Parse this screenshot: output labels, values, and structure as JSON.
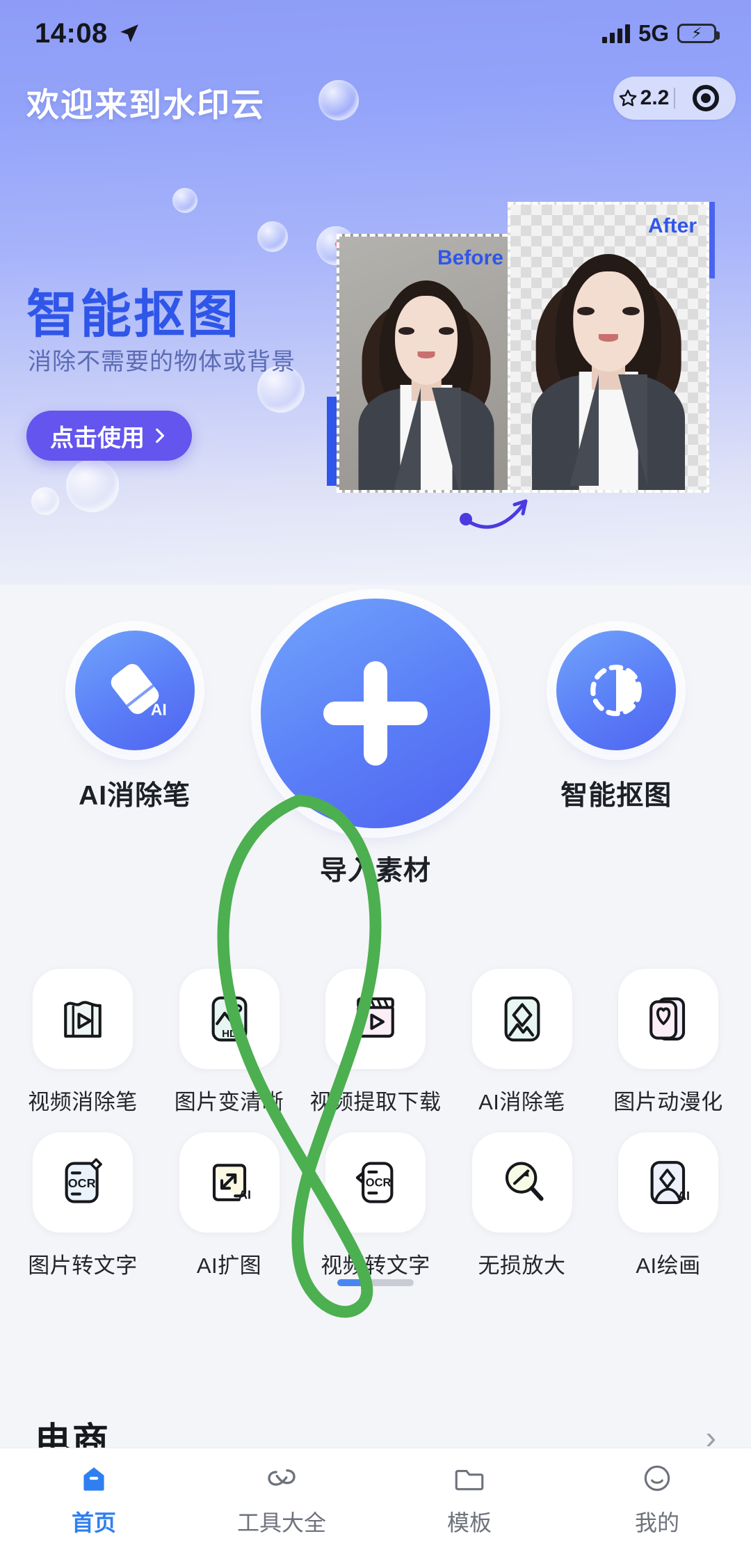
{
  "status_bar": {
    "time": "14:08",
    "location_icon": "location-arrow-icon",
    "network": "5G",
    "signal_icon": "signal-bars-icon",
    "battery_icon": "battery-charging-icon"
  },
  "header": {
    "greeting": "欢迎来到水印云",
    "capsule": {
      "star_icon": "star-icon",
      "score": "2.2",
      "target_icon": "target-icon"
    }
  },
  "banner": {
    "title": "智能抠图",
    "subtitle": "消除不需要的物体或背景",
    "button_label": "点击使用",
    "button_chevron": "chevron-right-icon",
    "before_label": "Before",
    "after_label": "After",
    "arrow_icon": "curved-arrow-icon"
  },
  "main_actions": [
    {
      "label": "AI消除笔",
      "icon": "eraser-ai-icon"
    },
    {
      "label": "导入素材",
      "icon": "plus-icon"
    },
    {
      "label": "智能抠图",
      "icon": "cutout-dashed-circle-icon"
    }
  ],
  "tools": {
    "row1": [
      {
        "label": "视频消除笔",
        "icon": "video-eraser-icon"
      },
      {
        "label": "图片变清晰",
        "icon": "image-hd-icon"
      },
      {
        "label": "视频提取下载",
        "icon": "video-download-icon"
      },
      {
        "label": "AI消除笔",
        "icon": "ai-eraser-image-icon"
      },
      {
        "label": "图片动漫化",
        "icon": "image-anime-icon"
      }
    ],
    "row2": [
      {
        "label": "图片转文字",
        "icon": "ocr-image-icon"
      },
      {
        "label": "AI扩图",
        "icon": "ai-expand-icon"
      },
      {
        "label": "视频转文字",
        "icon": "video-ocr-icon"
      },
      {
        "label": "无损放大",
        "icon": "magnifier-icon"
      },
      {
        "label": "AI绘画",
        "icon": "ai-paint-icon"
      }
    ]
  },
  "section": {
    "title": "电商",
    "more_icon": "chevron-right-icon"
  },
  "tabbar": [
    {
      "label": "首页",
      "icon": "home-icon",
      "active": true
    },
    {
      "label": "工具大全",
      "icon": "tools-icon",
      "active": false
    },
    {
      "label": "模板",
      "icon": "folder-icon",
      "active": false
    },
    {
      "label": "我的",
      "icon": "smiley-icon",
      "active": false
    }
  ],
  "colors": {
    "accent_blue": "#2f56e8",
    "button_purple": "#6355ee",
    "tab_active": "#2f7ff0",
    "annotation_green": "#4caf50",
    "battery_green": "#34d158"
  }
}
